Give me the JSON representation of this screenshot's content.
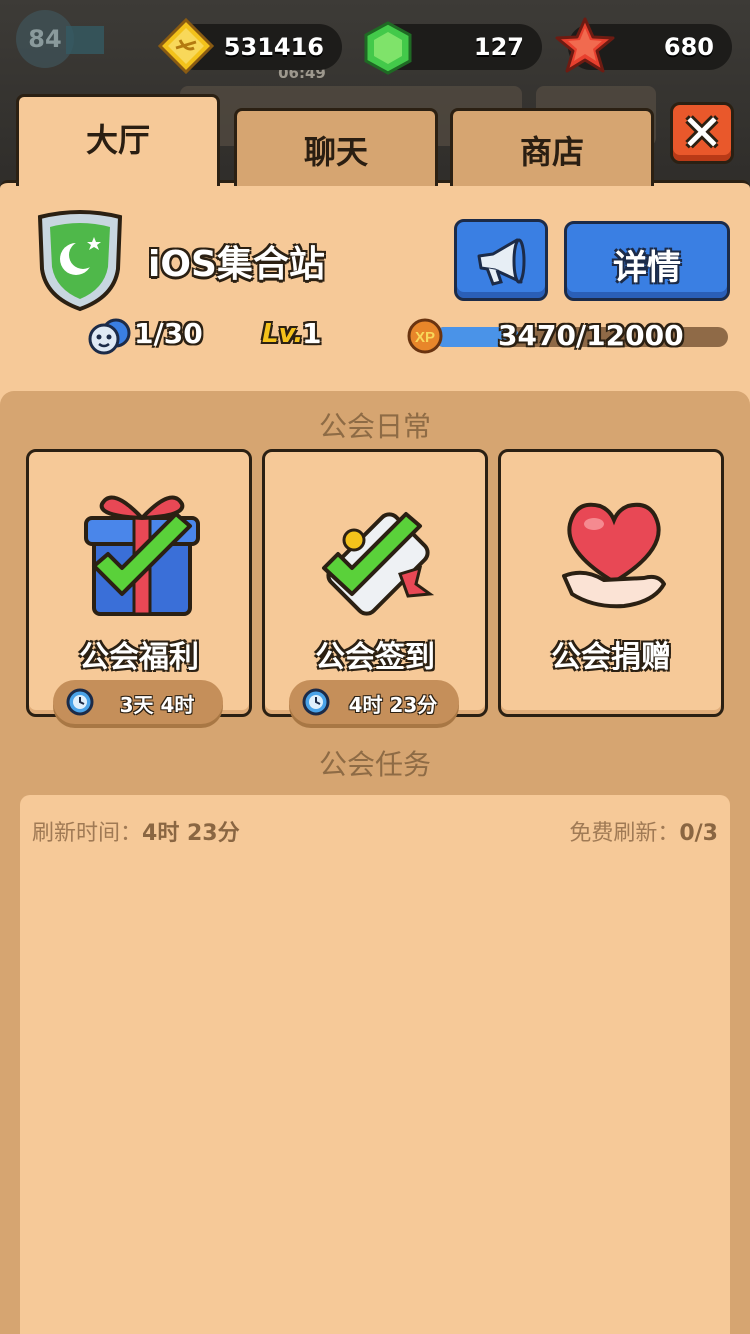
{
  "background": {
    "level_badge": "84",
    "ghost_timer": "06:49"
  },
  "currencies": {
    "gold": "531416",
    "gems": "127",
    "stars": "680"
  },
  "tabs": {
    "lobby": "大厅",
    "chat": "聊天",
    "shop": "商店"
  },
  "guild": {
    "name": "iOS集合站",
    "members": "1/30",
    "level_label": "Lv.",
    "level": "1",
    "xp_text": "3470/12000",
    "xp_progress": 0.289,
    "details_button": "详情"
  },
  "daily": {
    "title": "公会日常",
    "cards": [
      {
        "label": "公会福利",
        "timer": "3天 4时"
      },
      {
        "label": "公会签到",
        "timer": "4时 23分"
      },
      {
        "label": "公会捐赠"
      }
    ]
  },
  "tasks": {
    "title": "公会任务",
    "refresh_label": "刷新时间：",
    "refresh_value": "4时 23分",
    "free_refresh_label": "免费刷新：",
    "free_refresh_value": "0/3"
  },
  "colors": {
    "panel": "#f6c998",
    "panel_dark": "#d6a571",
    "button_blue": "#3a7fe3",
    "close_red": "#e9582b",
    "xp_blue": "#4a93e8"
  },
  "icons": [
    "gold-coin-icon",
    "gem-icon",
    "star-icon",
    "close-icon",
    "guild-shield-icon",
    "megaphone-icon",
    "members-icon",
    "xp-icon",
    "gift-check-icon",
    "scroll-check-icon",
    "heart-hand-icon",
    "clock-icon"
  ]
}
